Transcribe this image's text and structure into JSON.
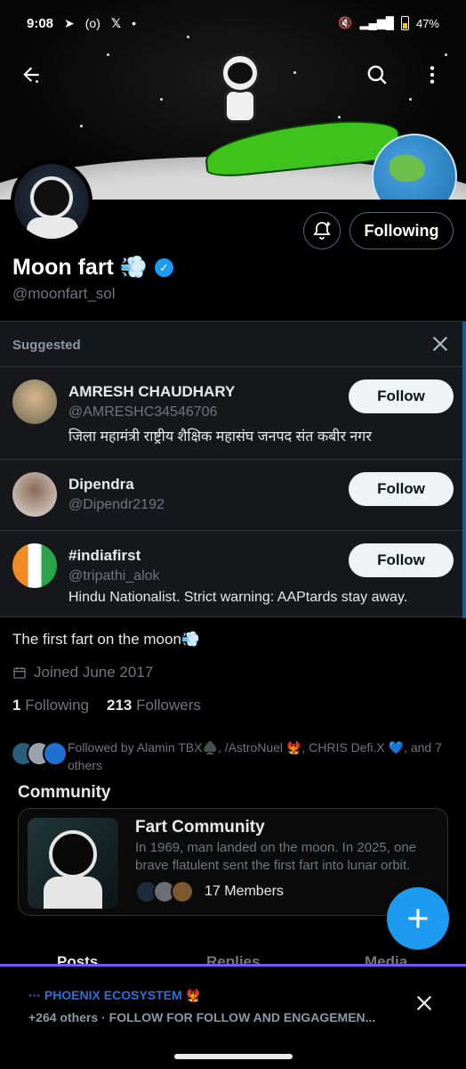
{
  "status_bar": {
    "time": "9:08",
    "icons": [
      "telegram-icon",
      "hotspot-icon",
      "x-logo-icon",
      "dot-icon"
    ],
    "battery": "47%"
  },
  "header": {
    "back_icon": "arrow-left-icon",
    "search_icon": "search-icon",
    "more_icon": "more-vertical-icon"
  },
  "profile": {
    "name": "Moon fart 💨",
    "handle": "@moonfart_sol",
    "following_label": "Following",
    "bio": "The first fart on the moon💨",
    "joined": "Joined June 2017",
    "following_count": "1",
    "following_label_stat": "Following",
    "followers_count": "213",
    "followers_label_stat": "Followers",
    "followed_by": "Followed by Alamin TBX♠️, /AstroNuel 🐦‍🔥, CHRIS Defi.X 💙, and 7 others"
  },
  "suggested": {
    "title": "Suggested",
    "follow_label": "Follow",
    "items": [
      {
        "name": "AMRESH CHAUDHARY",
        "handle": "@AMRESHC34546706",
        "bio": "जिला महामंत्री राष्ट्रीय शैक्षिक महासंघ जनपद संत कबीर नगर",
        "avatar_color": "#8a7a5a"
      },
      {
        "name": "Dipendra",
        "handle": "@Dipendr2192",
        "bio": "",
        "avatar_color": "#c9c2b8"
      },
      {
        "name": "#indiafirst",
        "handle": "@tripathi_alok",
        "bio": "Hindu Nationalist. Strict warning: AAPtards stay away.",
        "avatar_color": "#e88a2a"
      }
    ]
  },
  "community": {
    "title": "Community",
    "name": "Fart Community",
    "description": "In 1969, man landed on the moon. In 2025, one brave flatulent sent the first fart into lunar orbit.",
    "members": "17 Members"
  },
  "tabs": [
    "Posts",
    "Replies",
    "Media"
  ],
  "notification": {
    "title": "··· PHOENIX ECOSYSTEM 🐦‍🔥",
    "subtitle": "+264 others · FOLLOW FOR FOLLOW AND ENGAGEMEN..."
  },
  "colors": {
    "accent": "#1d9bf0",
    "background": "#000000",
    "panel": "#16181c"
  }
}
